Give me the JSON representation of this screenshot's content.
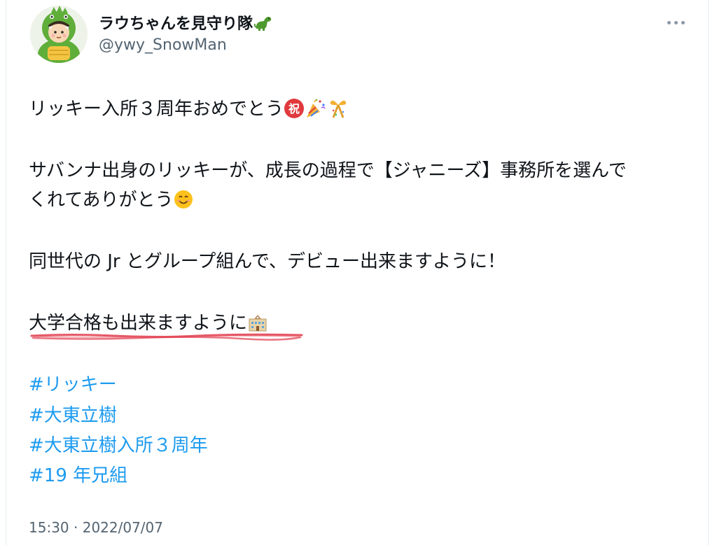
{
  "author": {
    "display_name": "ラウちゃんを見守り隊",
    "display_name_emoji": "dinosaur-icon",
    "handle": "@ywy_SnowMan",
    "avatar": "dinosaur-costume-avatar"
  },
  "menu": {
    "icon": "more-horizontal-icon"
  },
  "tweet": {
    "lines": [
      "リッキー入所３周年おめでとう",
      "サバンナ出身のリッキーが、成長の過程で【ジャニーズ】事務所を選んで",
      "くれてありがとう",
      "同世代の Jr とグループ組んで、デビュー出来ますように！",
      "大学合格も出来ますように"
    ],
    "emojis": {
      "line1": [
        "congratulations-icon",
        "party-popper-icon",
        "ribbon-gift-icon"
      ],
      "line3": [
        "smiling-face-icon"
      ],
      "line5": [
        "school-icon"
      ]
    },
    "hashtags": [
      "#リッキー",
      "#大東立樹",
      "#大東立樹入所３周年",
      "#19 年兄組"
    ],
    "highlight_color": "#e0394a"
  },
  "meta": {
    "time": "15:30",
    "separator": "·",
    "date": "2022/07/07"
  },
  "colors": {
    "text": "#0f1419",
    "secondary": "#536471",
    "link": "#1d9bf0"
  }
}
